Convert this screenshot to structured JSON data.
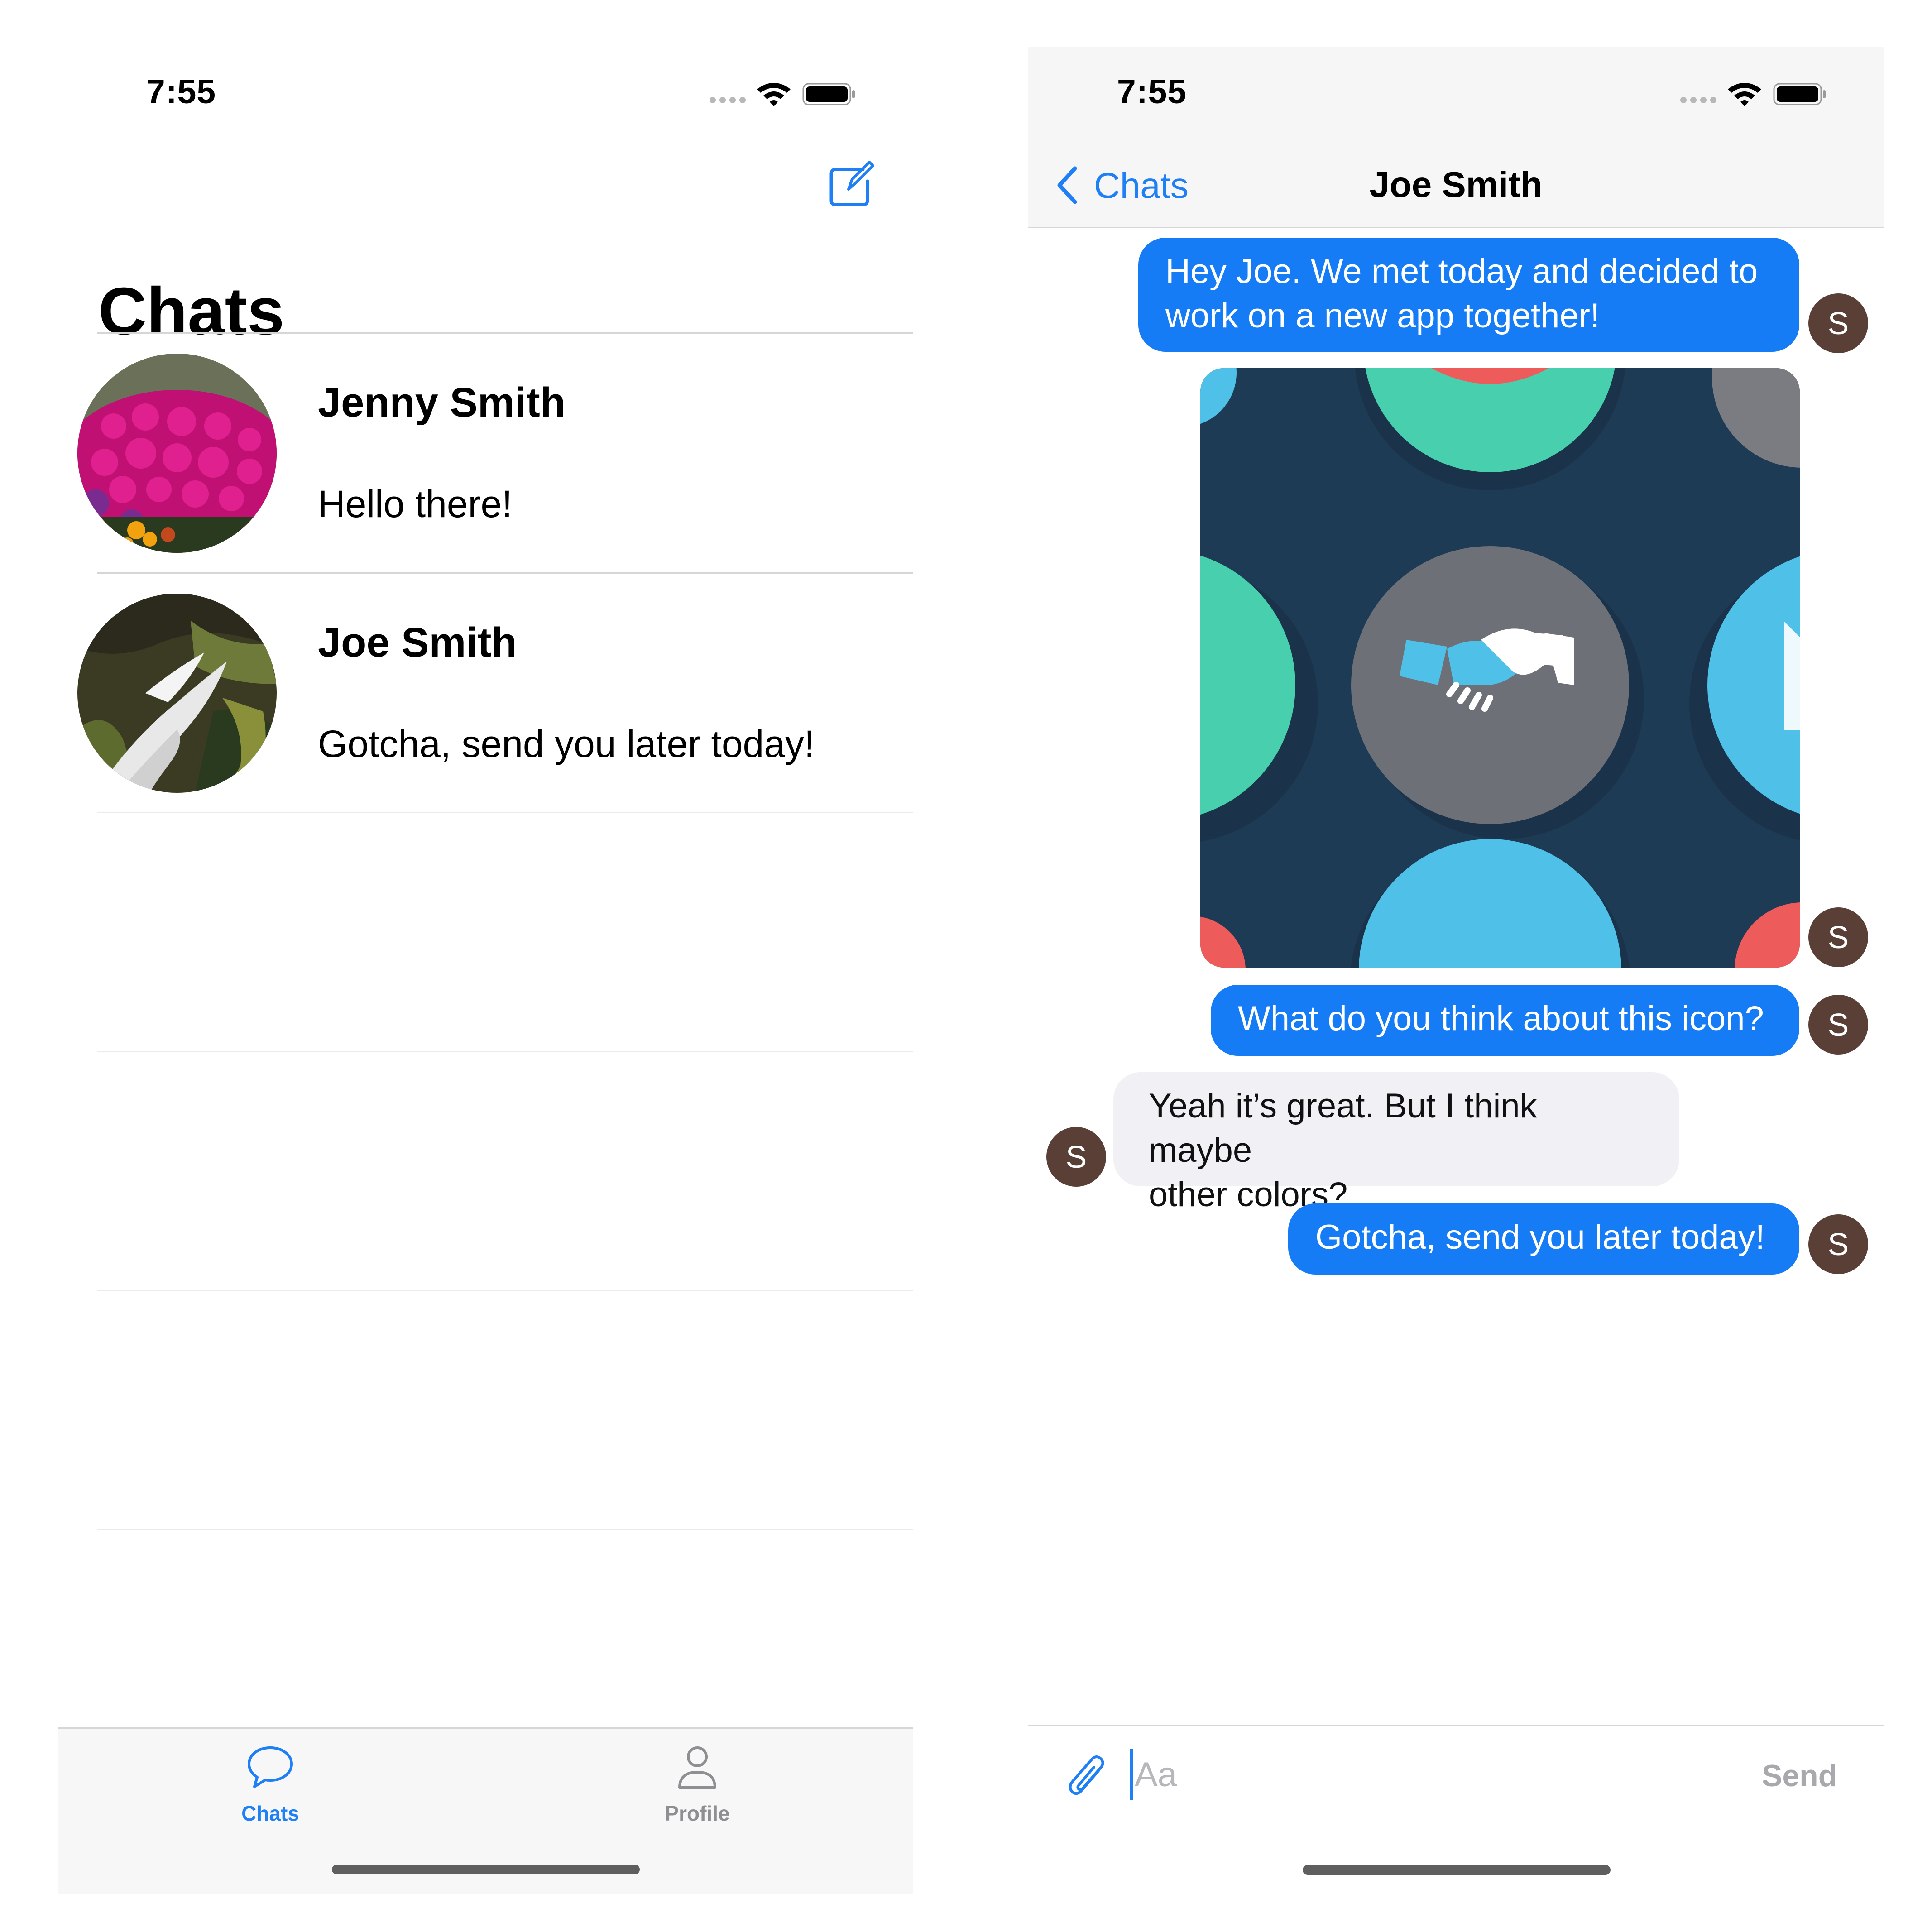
{
  "colors": {
    "accent": "#1f7ff5",
    "outgoing_bubble": "#157cf6",
    "incoming_bubble": "#f1f1f5",
    "avatar_bg": "#5a3f37",
    "tab_inactive": "#8e8e93",
    "send_disabled": "#a8a8ad"
  },
  "left_screen": {
    "status_bar": {
      "time": "7:55"
    },
    "header": {
      "title": "Chats",
      "compose_icon": "compose-icon"
    },
    "chats": [
      {
        "name": "Jenny Smith",
        "preview": "Hello there!",
        "avatar": "flowers-photo"
      },
      {
        "name": "Joe Smith",
        "preview": "Gotcha, send you later today!",
        "avatar": "waterfall-photo"
      }
    ],
    "tabbar": {
      "tabs": [
        {
          "label": "Chats",
          "icon": "chat-bubble-icon",
          "active": true
        },
        {
          "label": "Profile",
          "icon": "person-icon",
          "active": false
        }
      ]
    }
  },
  "right_screen": {
    "status_bar": {
      "time": "7:55"
    },
    "nav": {
      "back_label": "Chats",
      "title": "Joe Smith"
    },
    "messages": [
      {
        "direction": "outgoing",
        "lines": [
          "Hey Joe. We met today and decided to",
          "work on a new app together!"
        ],
        "avatar_initial": "S"
      },
      {
        "direction": "outgoing",
        "type": "image",
        "image": "handshake-pattern-image",
        "avatar_initial": "S"
      },
      {
        "direction": "outgoing",
        "text": "What do you think about this icon?",
        "avatar_initial": "S"
      },
      {
        "direction": "incoming",
        "lines": [
          "Yeah it’s great. But I think maybe",
          "other colors?"
        ],
        "avatar_initial": "S"
      },
      {
        "direction": "outgoing",
        "text": "Gotcha, send you later today!",
        "avatar_initial": "S"
      }
    ],
    "composer": {
      "placeholder": "Aa",
      "value": "",
      "send_label": "Send",
      "attach_icon": "paperclip-icon"
    }
  }
}
